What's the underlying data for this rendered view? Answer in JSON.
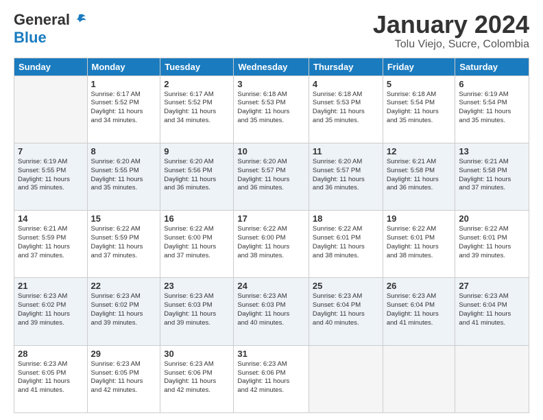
{
  "logo": {
    "general": "General",
    "blue": "Blue"
  },
  "title": "January 2024",
  "location": "Tolu Viejo, Sucre, Colombia",
  "days_header": [
    "Sunday",
    "Monday",
    "Tuesday",
    "Wednesday",
    "Thursday",
    "Friday",
    "Saturday"
  ],
  "weeks": [
    [
      {
        "day": "",
        "info": ""
      },
      {
        "day": "1",
        "info": "Sunrise: 6:17 AM\nSunset: 5:52 PM\nDaylight: 11 hours\nand 34 minutes."
      },
      {
        "day": "2",
        "info": "Sunrise: 6:17 AM\nSunset: 5:52 PM\nDaylight: 11 hours\nand 34 minutes."
      },
      {
        "day": "3",
        "info": "Sunrise: 6:18 AM\nSunset: 5:53 PM\nDaylight: 11 hours\nand 35 minutes."
      },
      {
        "day": "4",
        "info": "Sunrise: 6:18 AM\nSunset: 5:53 PM\nDaylight: 11 hours\nand 35 minutes."
      },
      {
        "day": "5",
        "info": "Sunrise: 6:18 AM\nSunset: 5:54 PM\nDaylight: 11 hours\nand 35 minutes."
      },
      {
        "day": "6",
        "info": "Sunrise: 6:19 AM\nSunset: 5:54 PM\nDaylight: 11 hours\nand 35 minutes."
      }
    ],
    [
      {
        "day": "7",
        "info": "Sunrise: 6:19 AM\nSunset: 5:55 PM\nDaylight: 11 hours\nand 35 minutes."
      },
      {
        "day": "8",
        "info": "Sunrise: 6:20 AM\nSunset: 5:55 PM\nDaylight: 11 hours\nand 35 minutes."
      },
      {
        "day": "9",
        "info": "Sunrise: 6:20 AM\nSunset: 5:56 PM\nDaylight: 11 hours\nand 36 minutes."
      },
      {
        "day": "10",
        "info": "Sunrise: 6:20 AM\nSunset: 5:57 PM\nDaylight: 11 hours\nand 36 minutes."
      },
      {
        "day": "11",
        "info": "Sunrise: 6:20 AM\nSunset: 5:57 PM\nDaylight: 11 hours\nand 36 minutes."
      },
      {
        "day": "12",
        "info": "Sunrise: 6:21 AM\nSunset: 5:58 PM\nDaylight: 11 hours\nand 36 minutes."
      },
      {
        "day": "13",
        "info": "Sunrise: 6:21 AM\nSunset: 5:58 PM\nDaylight: 11 hours\nand 37 minutes."
      }
    ],
    [
      {
        "day": "14",
        "info": "Sunrise: 6:21 AM\nSunset: 5:59 PM\nDaylight: 11 hours\nand 37 minutes."
      },
      {
        "day": "15",
        "info": "Sunrise: 6:22 AM\nSunset: 5:59 PM\nDaylight: 11 hours\nand 37 minutes."
      },
      {
        "day": "16",
        "info": "Sunrise: 6:22 AM\nSunset: 6:00 PM\nDaylight: 11 hours\nand 37 minutes."
      },
      {
        "day": "17",
        "info": "Sunrise: 6:22 AM\nSunset: 6:00 PM\nDaylight: 11 hours\nand 38 minutes."
      },
      {
        "day": "18",
        "info": "Sunrise: 6:22 AM\nSunset: 6:01 PM\nDaylight: 11 hours\nand 38 minutes."
      },
      {
        "day": "19",
        "info": "Sunrise: 6:22 AM\nSunset: 6:01 PM\nDaylight: 11 hours\nand 38 minutes."
      },
      {
        "day": "20",
        "info": "Sunrise: 6:22 AM\nSunset: 6:01 PM\nDaylight: 11 hours\nand 39 minutes."
      }
    ],
    [
      {
        "day": "21",
        "info": "Sunrise: 6:23 AM\nSunset: 6:02 PM\nDaylight: 11 hours\nand 39 minutes."
      },
      {
        "day": "22",
        "info": "Sunrise: 6:23 AM\nSunset: 6:02 PM\nDaylight: 11 hours\nand 39 minutes."
      },
      {
        "day": "23",
        "info": "Sunrise: 6:23 AM\nSunset: 6:03 PM\nDaylight: 11 hours\nand 39 minutes."
      },
      {
        "day": "24",
        "info": "Sunrise: 6:23 AM\nSunset: 6:03 PM\nDaylight: 11 hours\nand 40 minutes."
      },
      {
        "day": "25",
        "info": "Sunrise: 6:23 AM\nSunset: 6:04 PM\nDaylight: 11 hours\nand 40 minutes."
      },
      {
        "day": "26",
        "info": "Sunrise: 6:23 AM\nSunset: 6:04 PM\nDaylight: 11 hours\nand 41 minutes."
      },
      {
        "day": "27",
        "info": "Sunrise: 6:23 AM\nSunset: 6:04 PM\nDaylight: 11 hours\nand 41 minutes."
      }
    ],
    [
      {
        "day": "28",
        "info": "Sunrise: 6:23 AM\nSunset: 6:05 PM\nDaylight: 11 hours\nand 41 minutes."
      },
      {
        "day": "29",
        "info": "Sunrise: 6:23 AM\nSunset: 6:05 PM\nDaylight: 11 hours\nand 42 minutes."
      },
      {
        "day": "30",
        "info": "Sunrise: 6:23 AM\nSunset: 6:06 PM\nDaylight: 11 hours\nand 42 minutes."
      },
      {
        "day": "31",
        "info": "Sunrise: 6:23 AM\nSunset: 6:06 PM\nDaylight: 11 hours\nand 42 minutes."
      },
      {
        "day": "",
        "info": ""
      },
      {
        "day": "",
        "info": ""
      },
      {
        "day": "",
        "info": ""
      }
    ]
  ]
}
